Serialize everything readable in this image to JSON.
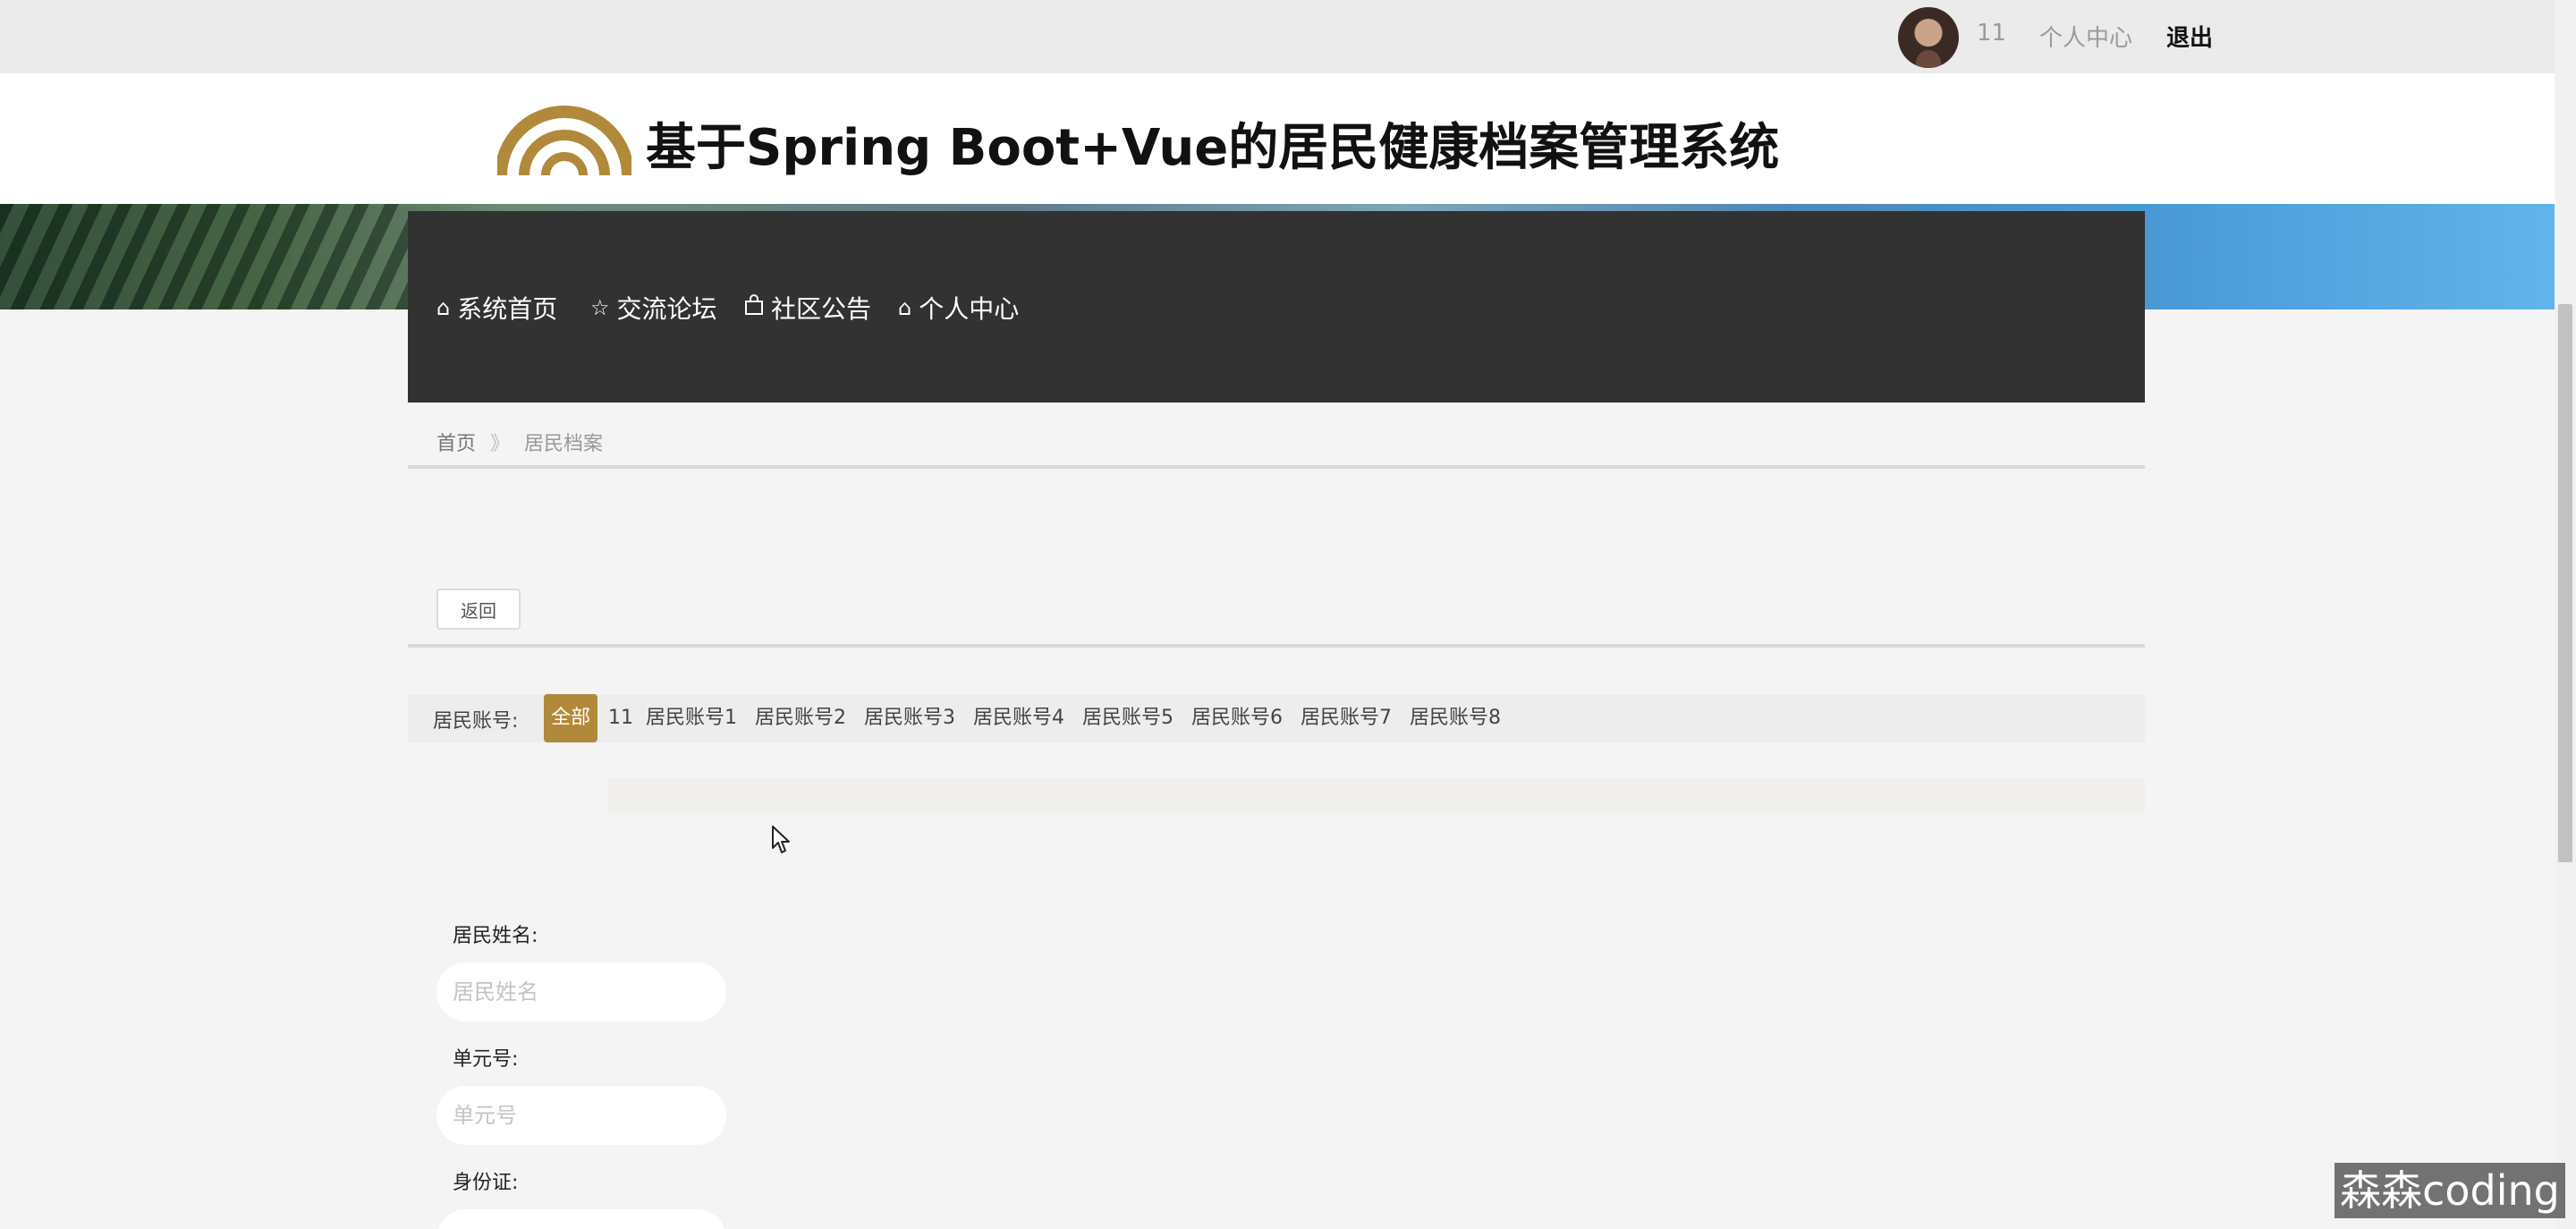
{
  "topbar": {
    "username": "11",
    "personal_center": "个人中心",
    "logout": "退出"
  },
  "header": {
    "title": "基于Spring Boot+Vue的居民健康档案管理系统",
    "brand_color": "#b0893a"
  },
  "nav": {
    "items": [
      {
        "icon": "home-icon",
        "label": "系统首页"
      },
      {
        "icon": "star-icon",
        "label": "交流论坛"
      },
      {
        "icon": "bag-icon",
        "label": "社区公告"
      },
      {
        "icon": "home-icon",
        "label": "个人中心"
      }
    ]
  },
  "breadcrumb": {
    "home": "首页",
    "separator": "》",
    "current": "居民档案"
  },
  "actions": {
    "back": "返回"
  },
  "filter": {
    "label": "居民账号:",
    "options": [
      "全部",
      "11",
      "居民账号1",
      "居民账号2",
      "居民账号3",
      "居民账号4",
      "居民账号5",
      "居民账号6",
      "居民账号7",
      "居民账号8"
    ],
    "selected": "全部"
  },
  "form": {
    "name": {
      "label": "居民姓名:",
      "placeholder": "居民姓名"
    },
    "unit": {
      "label": "单元号:",
      "placeholder": "单元号"
    },
    "idcard": {
      "label": "身份证:",
      "placeholder": ""
    }
  },
  "watermark": "森森coding"
}
